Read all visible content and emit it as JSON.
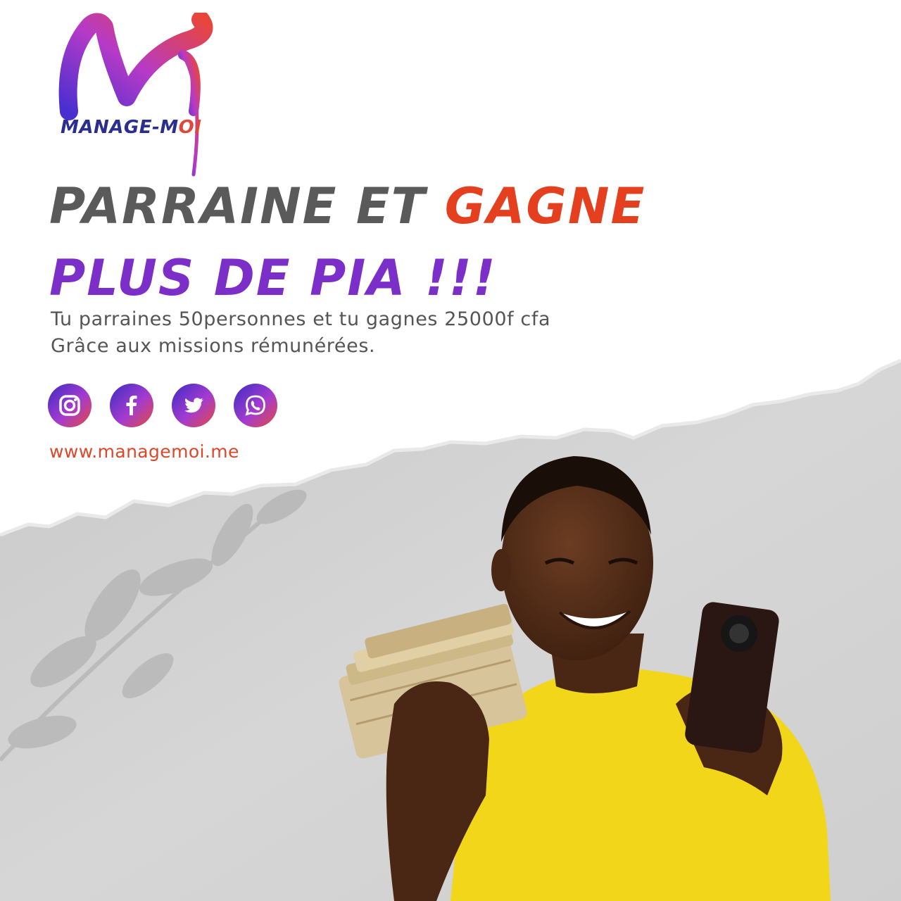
{
  "brand": {
    "logo_text_main": "MANAGE-M",
    "logo_text_accent": "OI"
  },
  "headline": {
    "line1_part1": "PARRAINE ET ",
    "line1_accent": "GAGNE",
    "line2": "PLUS DE PIA !!!"
  },
  "description": {
    "line1": "Tu parraines 50personnes et tu gagnes 25000f cfa",
    "line2": "Grâce aux missions rémunérées."
  },
  "social": [
    {
      "icon": "instagram-icon"
    },
    {
      "icon": "facebook-icon"
    },
    {
      "icon": "twitter-icon"
    },
    {
      "icon": "whatsapp-icon"
    }
  ],
  "website": "www.managemoi.me",
  "colors": {
    "headline_gray": "#5a5a5a",
    "headline_accent": "#e4401f",
    "headline_purple": "#7b2fc8",
    "website": "#e0462a",
    "gradient_start": "#3b2cc2",
    "gradient_end": "#e44a3d",
    "shirt": "#f2d61a"
  }
}
